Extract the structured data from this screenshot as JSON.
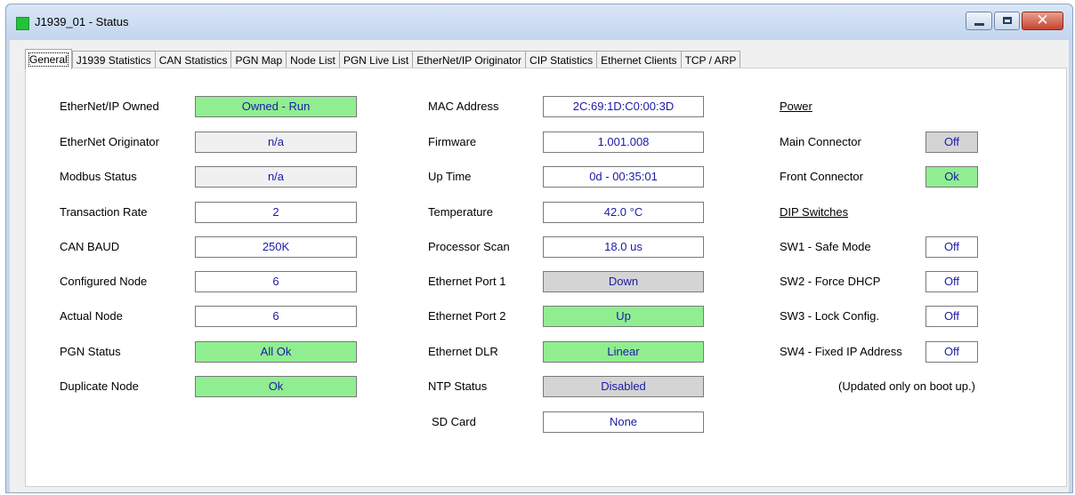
{
  "window": {
    "title": "J1939_01 - Status",
    "close_glyph": "✕"
  },
  "tabs": [
    "General",
    "J1939 Statistics",
    "CAN Statistics",
    "PGN Map",
    "Node List",
    "PGN Live List",
    "EtherNet/IP Originator",
    "CIP Statistics",
    "Ethernet Clients",
    "TCP / ARP"
  ],
  "colors": {
    "green": "#90ee90",
    "gray": "#d4d4d4",
    "light": "#f0f0f0",
    "value_text": "#1a1aa8"
  },
  "left": [
    {
      "label": "EtherNet/IP Owned",
      "value": "Owned - Run",
      "state": "green"
    },
    {
      "label": "EtherNet Originator",
      "value": "n/a",
      "state": "light"
    },
    {
      "label": "Modbus Status",
      "value": "n/a",
      "state": "light"
    },
    {
      "label": "Transaction Rate",
      "value": "2",
      "state": "white"
    },
    {
      "label": "CAN BAUD",
      "value": "250K",
      "state": "white"
    },
    {
      "label": "Configured Node",
      "value": "6",
      "state": "white"
    },
    {
      "label": "Actual Node",
      "value": "6",
      "state": "white"
    },
    {
      "label": "PGN Status",
      "value": "All Ok",
      "state": "green"
    },
    {
      "label": "Duplicate Node",
      "value": "Ok",
      "state": "green"
    }
  ],
  "middle": [
    {
      "label": "MAC Address",
      "value": "2C:69:1D:C0:00:3D",
      "state": "white"
    },
    {
      "label": "Firmware",
      "value": "1.001.008",
      "state": "white"
    },
    {
      "label": "Up Time",
      "value": "0d - 00:35:01",
      "state": "white"
    },
    {
      "label": "Temperature",
      "value": "42.0 °C",
      "state": "white"
    },
    {
      "label": "Processor Scan",
      "value": "18.0 us",
      "state": "white"
    },
    {
      "label": "Ethernet Port 1",
      "value": "Down",
      "state": "gray"
    },
    {
      "label": "Ethernet Port 2",
      "value": "Up",
      "state": "green"
    },
    {
      "label": "Ethernet DLR",
      "value": "Linear",
      "state": "green"
    },
    {
      "label": "NTP Status",
      "value": "Disabled",
      "state": "gray"
    },
    {
      "label": "SD Card",
      "value": "None",
      "state": "white"
    }
  ],
  "right": {
    "power_heading": "Power",
    "power": [
      {
        "label": "Main Connector",
        "value": "Off",
        "state": "gray"
      },
      {
        "label": "Front Connector",
        "value": "Ok",
        "state": "green"
      }
    ],
    "dip_heading": "DIP Switches",
    "dip": [
      {
        "label": "SW1 - Safe Mode",
        "value": "Off",
        "state": "white"
      },
      {
        "label": "SW2 - Force DHCP",
        "value": "Off",
        "state": "white"
      },
      {
        "label": "SW3 - Lock Config.",
        "value": "Off",
        "state": "white"
      },
      {
        "label": "SW4 - Fixed IP Address",
        "value": "Off",
        "state": "white"
      }
    ],
    "note": "(Updated only on boot up.)"
  }
}
